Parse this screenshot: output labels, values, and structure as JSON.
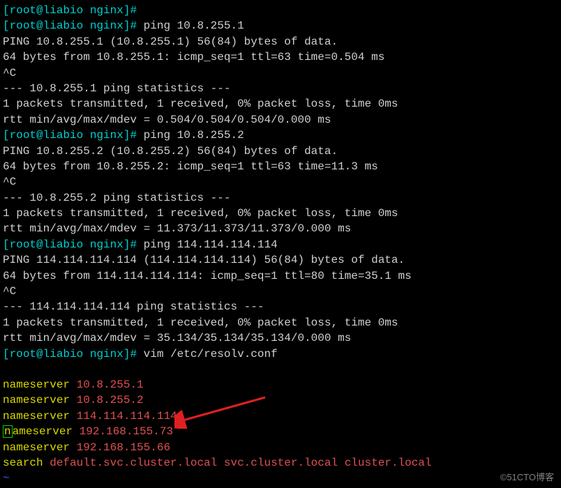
{
  "prompt0": {
    "open": "[",
    "user": "root@liabio",
    "space": " ",
    "path": "nginx",
    "close": "]#",
    "cmd": " "
  },
  "prompt1": {
    "open": "[",
    "user": "root@liabio",
    "space": " ",
    "path": "nginx",
    "close": "]#",
    "cmd": " ping 10.8.255.1"
  },
  "out1": [
    "PING 10.8.255.1 (10.8.255.1) 56(84) bytes of data.",
    "64 bytes from 10.8.255.1: icmp_seq=1 ttl=63 time=0.504 ms",
    "^C",
    "--- 10.8.255.1 ping statistics ---",
    "1 packets transmitted, 1 received, 0% packet loss, time 0ms",
    "rtt min/avg/max/mdev = 0.504/0.504/0.504/0.000 ms"
  ],
  "prompt2": {
    "open": "[",
    "user": "root@liabio",
    "space": " ",
    "path": "nginx",
    "close": "]#",
    "cmd": " ping 10.8.255.2"
  },
  "out2": [
    "PING 10.8.255.2 (10.8.255.2) 56(84) bytes of data.",
    "64 bytes from 10.8.255.2: icmp_seq=1 ttl=63 time=11.3 ms",
    "^C",
    "--- 10.8.255.2 ping statistics ---",
    "1 packets transmitted, 1 received, 0% packet loss, time 0ms",
    "rtt min/avg/max/mdev = 11.373/11.373/11.373/0.000 ms"
  ],
  "prompt3": {
    "open": "[",
    "user": "root@liabio",
    "space": " ",
    "path": "nginx",
    "close": "]#",
    "cmd": " ping 114.114.114.114"
  },
  "out3": [
    "PING 114.114.114.114 (114.114.114.114) 56(84) bytes of data.",
    "64 bytes from 114.114.114.114: icmp_seq=1 ttl=80 time=35.1 ms",
    "^C",
    "--- 114.114.114.114 ping statistics ---",
    "1 packets transmitted, 1 received, 0% packet loss, time 0ms",
    "rtt min/avg/max/mdev = 35.134/35.134/35.134/0.000 ms"
  ],
  "prompt4": {
    "open": "[",
    "user": "root@liabio",
    "space": " ",
    "path": "nginx",
    "close": "]#",
    "cmd": " vim /etc/resolv.conf"
  },
  "resolv": {
    "ns_label": "nameserver",
    "lines": [
      {
        "key": "nameserver",
        "val": "10.8.255.1",
        "cursor": false
      },
      {
        "key": "nameserver",
        "val": "10.8.255.2",
        "cursor": false
      },
      {
        "key": "nameserver",
        "val": "114.114.114.114",
        "cursor": false
      },
      {
        "key": "nameserver",
        "val": "192.168.155.73",
        "cursor": true
      },
      {
        "key": "nameserver",
        "val": "192.168.155.66",
        "cursor": false
      }
    ],
    "search_key": "search",
    "search_val": "default.svc.cluster.local svc.cluster.local cluster.local"
  },
  "tilde": "~",
  "watermark": "©51CTO博客"
}
